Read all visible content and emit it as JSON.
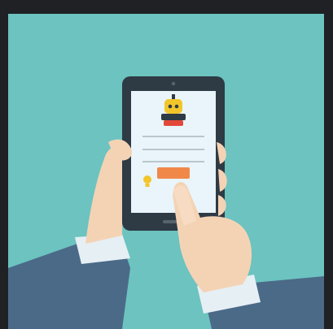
{
  "scene": {
    "frame_color": "#1f2124",
    "background_color": "#6cc3c0",
    "phone": {
      "body_color": "#2e3a44",
      "screen_color": "#e9f5fb",
      "app_logo": "robot-mascot-icon",
      "form_fields": [
        "username-line",
        "password-line"
      ],
      "action_button_color": "#f0884a",
      "tips_icon": "lightbulb-icon"
    },
    "hands": {
      "skin_color": "#f4d3b5",
      "sleeve_color": "#4b6a88",
      "cuff_color": "#e6eff4"
    }
  }
}
